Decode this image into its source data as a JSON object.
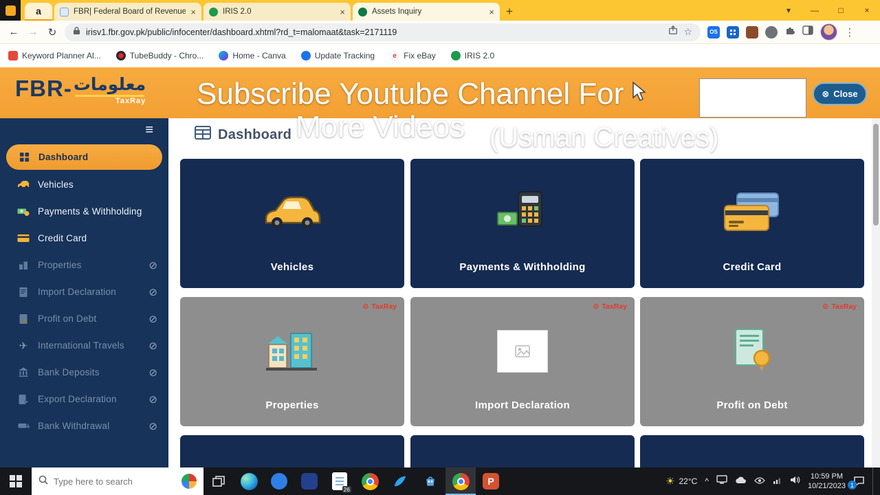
{
  "icons": {
    "back": "←",
    "forward": "→",
    "reload": "↻",
    "menu_dots": "⋮",
    "star": "☆",
    "hamburger": "≡",
    "blocked": "⊘",
    "close_circle": "⊗",
    "tab_close": "×",
    "new_tab": "+",
    "minimize": "—",
    "maximize": "□",
    "window_close": "×",
    "tab_chevron": "▾",
    "chevron_up": "^",
    "sun": "☀",
    "plane": "✈",
    "amazon_letter": "a",
    "os_badge": "OS",
    "ebay_letter": "e",
    "powerpoint_letter": "P"
  },
  "browser": {
    "tabs": [
      {
        "title": "FBR| Federal Board of Revenue"
      },
      {
        "title": "IRIS 2.0"
      },
      {
        "title": "Assets Inquiry"
      }
    ],
    "url": "irisv1.fbr.gov.pk/public/infocenter/dashboard.xhtml?rd_t=malomaat&task=2171119",
    "bookmarks": [
      {
        "label": "Keyword Planner Al..."
      },
      {
        "label": "TubeBuddy - Chro..."
      },
      {
        "label": "Home - Canva"
      },
      {
        "label": "Update Tracking"
      },
      {
        "label": "Fix eBay"
      },
      {
        "label": "IRIS 2.0"
      }
    ]
  },
  "header": {
    "logo_fbr": "FBR-",
    "logo_urdu": "معلومات",
    "logo_sub": "TaxRay",
    "overlay_line1": "Subscribe Youtube Channel For",
    "overlay_line2": "More Videos",
    "overlay_line3": "(Usman Creatives)",
    "close_button": "Close"
  },
  "sidebar": {
    "items": [
      {
        "label": "Dashboard"
      },
      {
        "label": "Vehicles"
      },
      {
        "label": "Payments & Withholding"
      },
      {
        "label": "Credit Card"
      },
      {
        "label": "Properties"
      },
      {
        "label": "Import Declaration"
      },
      {
        "label": "Profit on Debt"
      },
      {
        "label": "International Travels"
      },
      {
        "label": "Bank Deposits"
      },
      {
        "label": "Export Declaration"
      },
      {
        "label": "Bank Withdrawal"
      }
    ]
  },
  "main": {
    "title": "Dashboard",
    "cards": [
      {
        "label": "Vehicles"
      },
      {
        "label": "Payments & Withholding"
      },
      {
        "label": "Credit Card"
      },
      {
        "label": "Properties",
        "badge": "TaxRay"
      },
      {
        "label": "Import Declaration",
        "badge": "TaxRay"
      },
      {
        "label": "Profit on Debt",
        "badge": "TaxRay"
      }
    ]
  },
  "taskbar": {
    "search_placeholder": "Type here to search",
    "weather_temp": "22°C",
    "time": "10:59 PM",
    "date": "10/21/2023",
    "downloads_badge": "26",
    "notification_count": "1"
  },
  "colors": {
    "accent_orange": "#f5a338",
    "sidebar_navy": "#17335a",
    "card_navy": "#152b52",
    "disabled_gray": "#8e8e8e",
    "badge_red": "#e23b2e",
    "close_button_blue": "#1c5c8f",
    "frame_yellow": "#fcc532"
  }
}
